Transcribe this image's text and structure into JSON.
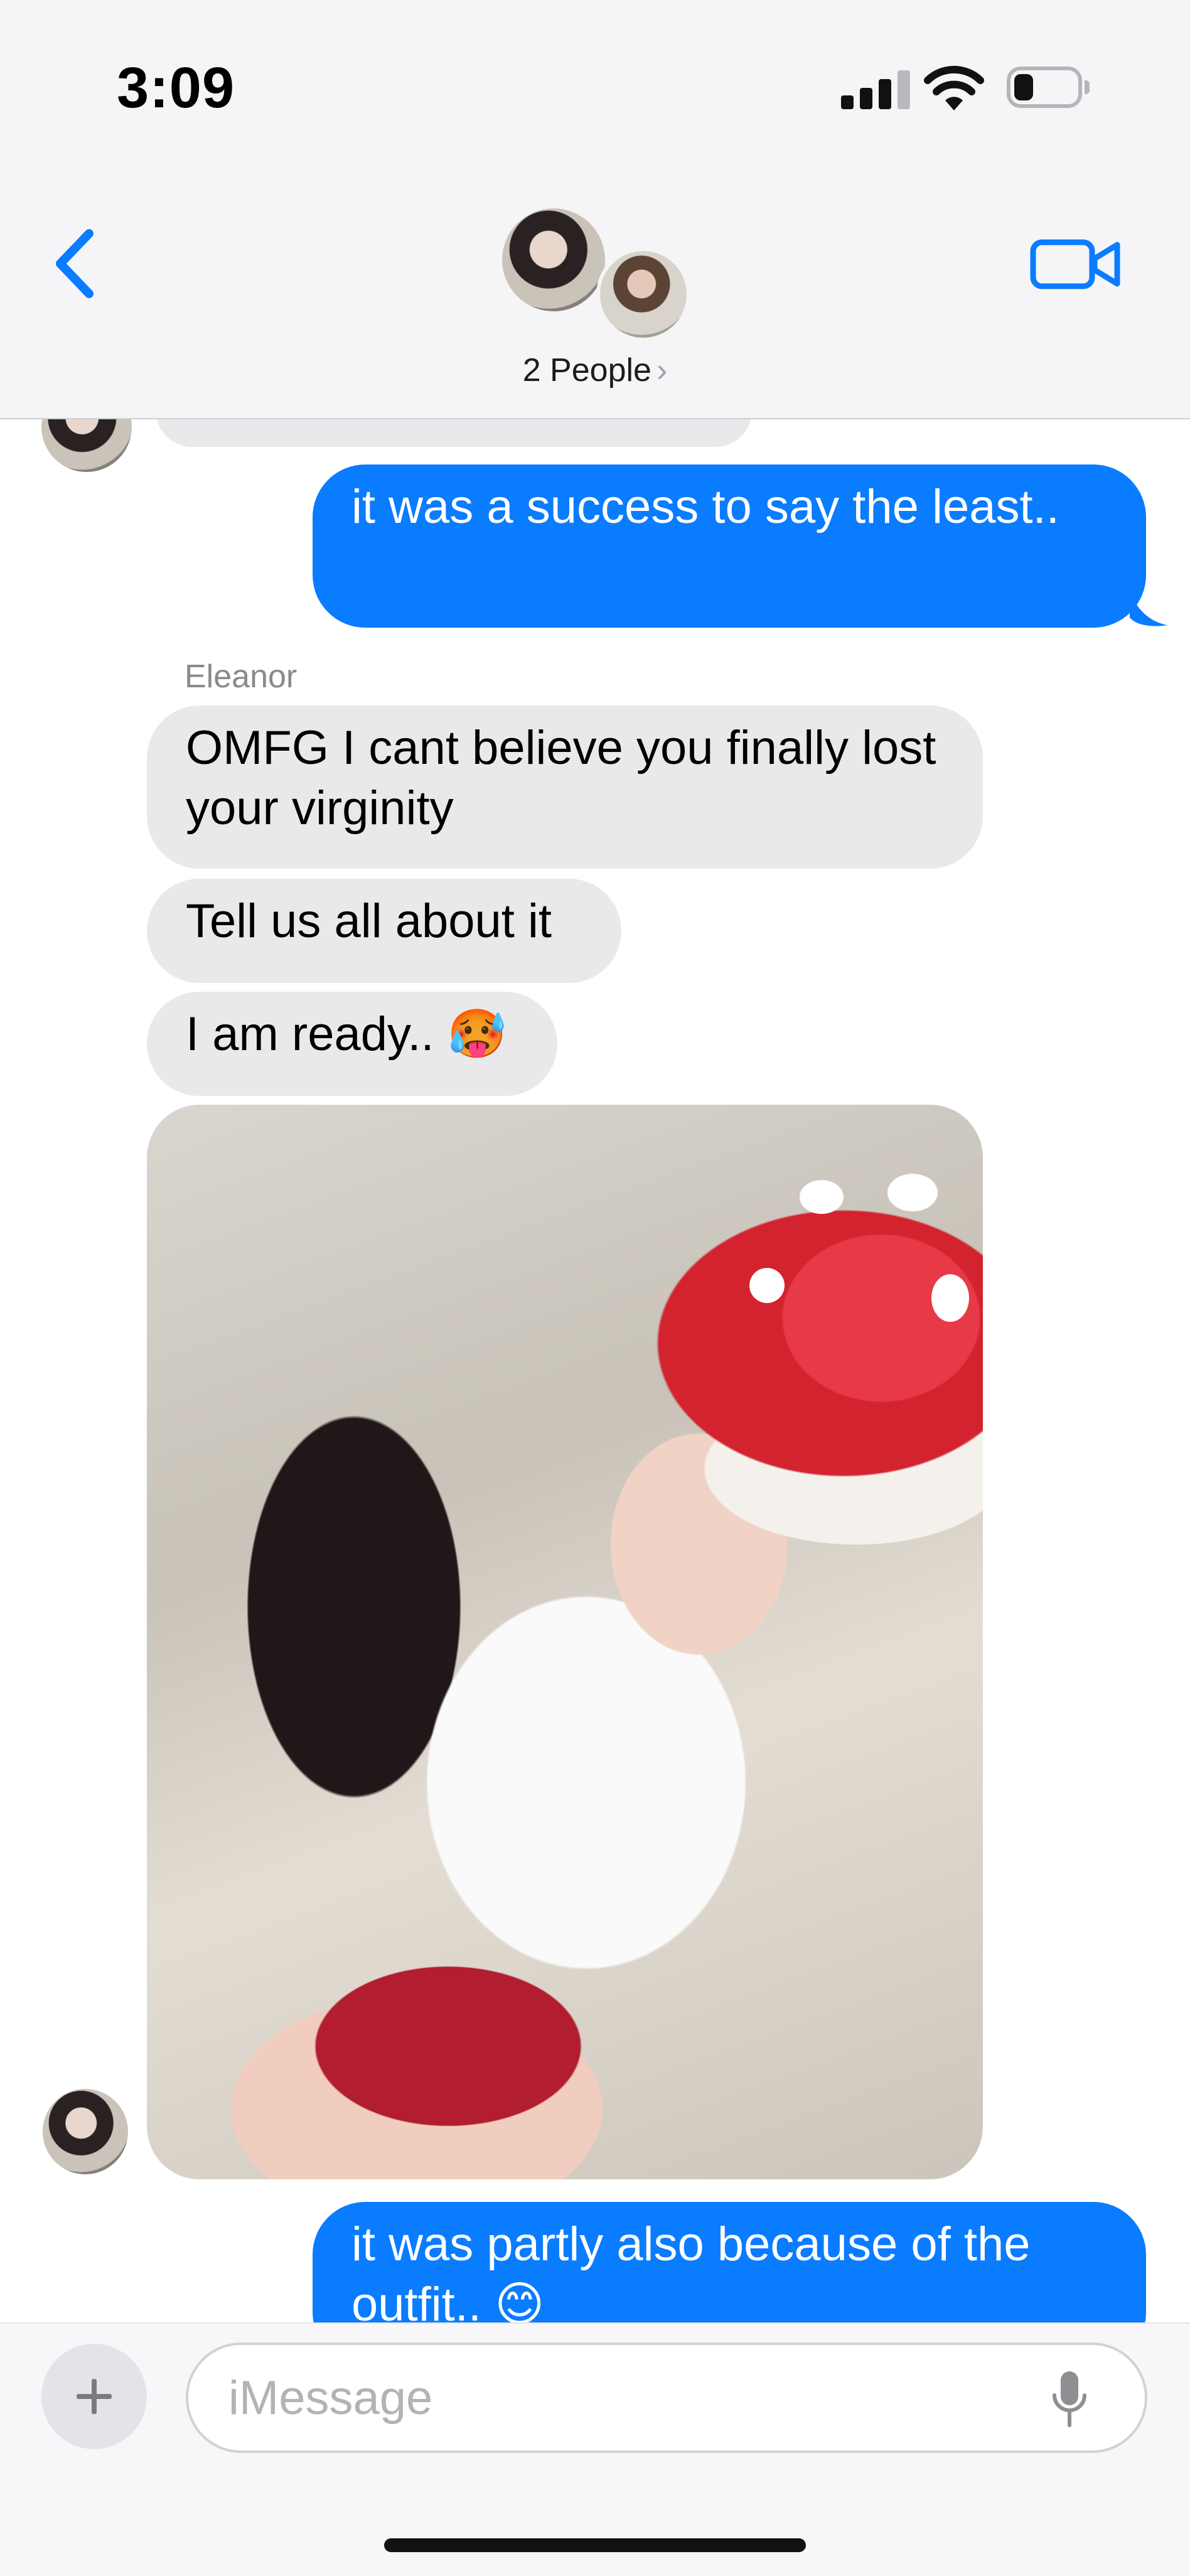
{
  "status_bar": {
    "time": "3:09",
    "signal_bars_active": 3,
    "signal_bars_total": 4,
    "battery_level_percent": 25
  },
  "header": {
    "back_icon": "chevron-left-icon",
    "video_icon": "video-camera-icon",
    "group_label": "2 People",
    "group_chevron": "›",
    "accent_color": "#0a7cff"
  },
  "messages": [
    {
      "type": "sent",
      "text": "it was a success to say the least.."
    },
    {
      "type": "sender_name",
      "text": "Eleanor"
    },
    {
      "type": "received",
      "text": "OMFG I cant believe you finally lost your virginity"
    },
    {
      "type": "received",
      "text": "Tell us all about it"
    },
    {
      "type": "received",
      "text": "I am ready.. 🥵"
    },
    {
      "type": "received_photo",
      "description": "photo-attachment"
    },
    {
      "type": "sent",
      "text": "it was partly also because of the outfit.. 😊"
    }
  ],
  "composer": {
    "placeholder": "iMessage",
    "plus_icon": "plus-icon",
    "mic_icon": "microphone-icon"
  },
  "colors": {
    "sent_bubble": "#0a7cff",
    "received_bubble": "#e9e9eb",
    "header_bg": "#f5f5f7"
  }
}
